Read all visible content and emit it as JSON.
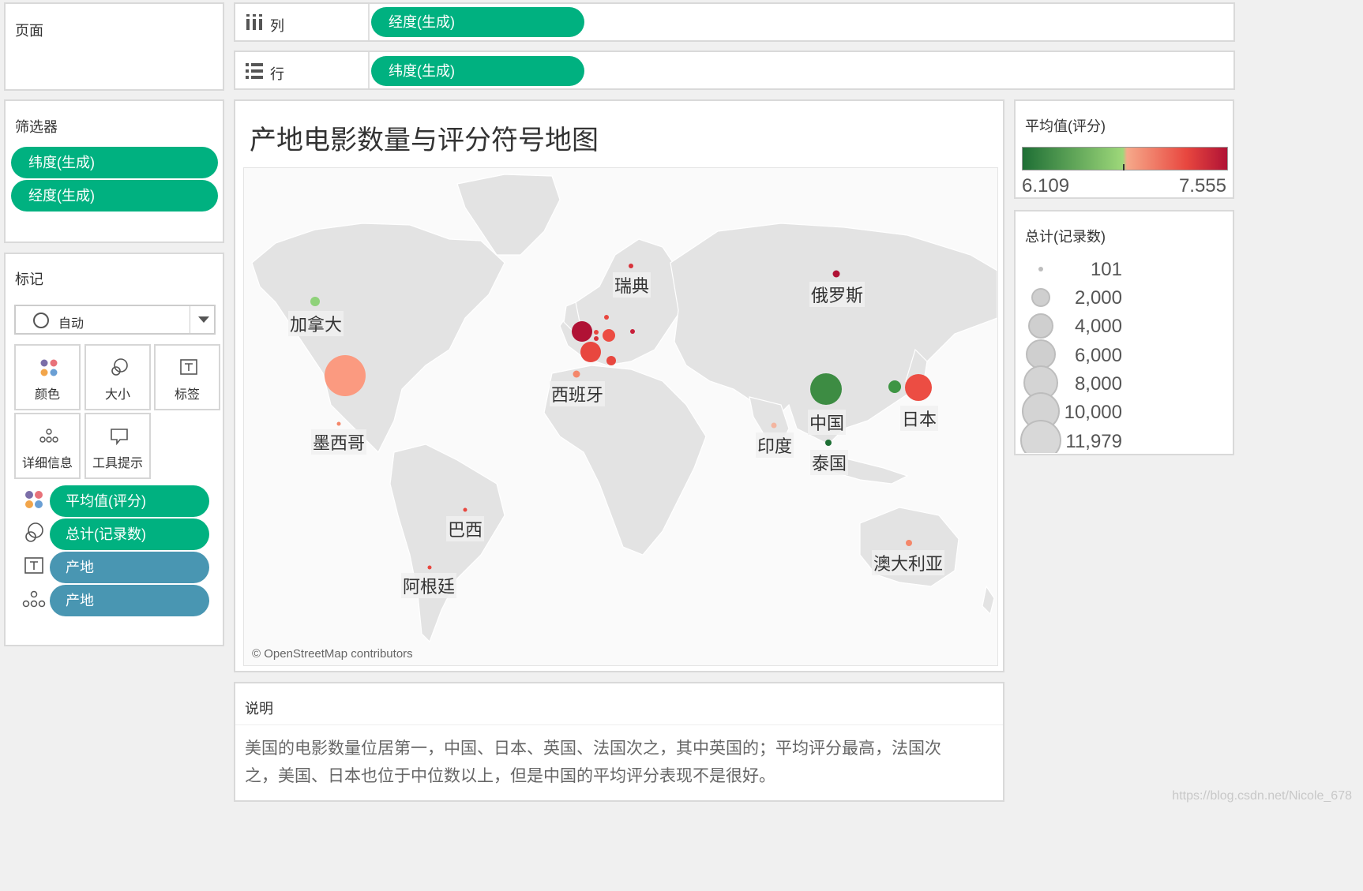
{
  "pages_panel": {
    "title": "页面"
  },
  "filters_panel": {
    "title": "筛选器",
    "items": [
      "纬度(生成)",
      "经度(生成)"
    ]
  },
  "marks_panel": {
    "title": "标记",
    "mark_type": "自动",
    "buttons": [
      "颜色",
      "大小",
      "标签",
      "详细信息",
      "工具提示"
    ],
    "fields": [
      {
        "label": "平均值(评分)",
        "kind": "measure",
        "icon": "color-dots-icon"
      },
      {
        "label": "总计(记录数)",
        "kind": "measure",
        "icon": "size-circles-icon"
      },
      {
        "label": "产地",
        "kind": "dimension",
        "icon": "text-icon"
      },
      {
        "label": "产地",
        "kind": "dimension",
        "icon": "detail-dots-icon"
      }
    ]
  },
  "shelves": {
    "columns": {
      "label": "列",
      "pill": "经度(生成)"
    },
    "rows": {
      "label": "行",
      "pill": "纬度(生成)"
    }
  },
  "map": {
    "title": "产地电影数量与评分符号地图",
    "attribution": "© OpenStreetMap contributors",
    "labels": [
      "瑞典",
      "俄罗斯",
      "加拿大",
      "西班牙",
      "日本",
      "中国",
      "墨西哥",
      "印度",
      "泰国",
      "巴西",
      "澳大利亚",
      "阿根廷"
    ]
  },
  "color_legend": {
    "title": "平均值(评分)",
    "min": "6.109",
    "max": "7.555",
    "gradient": [
      "#1e6f35",
      "#9ed87a",
      "#f6a98a",
      "#e8473f",
      "#b01235"
    ]
  },
  "size_legend": {
    "title": "总计(记录数)",
    "items": [
      "101",
      "2,000",
      "4,000",
      "6,000",
      "8,000",
      "10,000",
      "11,979"
    ]
  },
  "description": {
    "title": "说明",
    "line1": "美国的电影数量位居第一，中国、日本、英国、法国次之，其中英国的；平均评分最高，法国次",
    "line2": "之，美国、日本也位于中位数以上，但是中国的平均评分表现不是很好。"
  },
  "watermark": "https://blog.csdn.net/Nicole_678"
}
